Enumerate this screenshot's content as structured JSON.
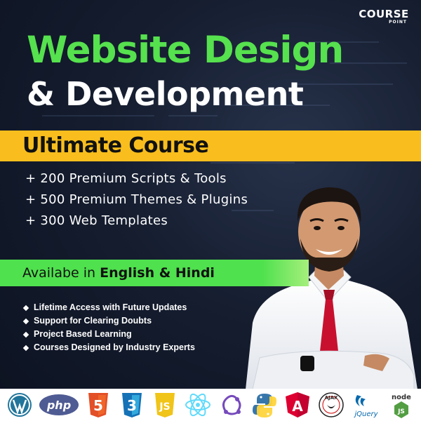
{
  "brand": {
    "name": "COURSE",
    "sub": "POINT"
  },
  "headline": {
    "line1": "Website Design",
    "line2": "& Development",
    "band": "Ultimate Course"
  },
  "features": [
    "+ 200 Premium Scripts & Tools",
    "+ 500 Premium Themes & Plugins",
    "+ 300 Web Templates"
  ],
  "availability": {
    "prefix": "Availabe in ",
    "languages": "English & Hindi"
  },
  "bullets": [
    "Lifetime Access with Future Updates",
    "Support for Clearing Doubts",
    "Project Based Learning",
    "Courses Designed by Industry Experts"
  ],
  "tech_icons": [
    {
      "name": "wordpress-icon",
      "label": ""
    },
    {
      "name": "php-icon",
      "label": "php"
    },
    {
      "name": "html5-icon",
      "label": "5"
    },
    {
      "name": "css3-icon",
      "label": "3"
    },
    {
      "name": "javascript-icon",
      "label": "JS"
    },
    {
      "name": "react-icon",
      "label": ""
    },
    {
      "name": "redux-icon",
      "label": ""
    },
    {
      "name": "python-icon",
      "label": ""
    },
    {
      "name": "angular-icon",
      "label": "A"
    },
    {
      "name": "ajax-icon",
      "label": "AJAX"
    },
    {
      "name": "jquery-icon",
      "label": "jQuery"
    },
    {
      "name": "nodejs-icon",
      "label": "node"
    }
  ],
  "colors": {
    "background": "#151d2f",
    "green": "#56e14e",
    "yellow": "#f9be1d",
    "white": "#ffffff"
  }
}
